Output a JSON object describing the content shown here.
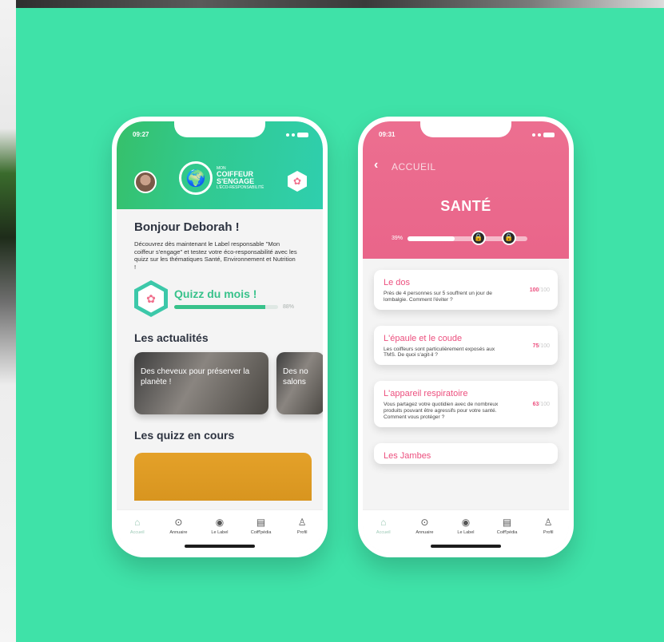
{
  "left_phone": {
    "time": "09:27",
    "logo": {
      "line1": "MON",
      "line2": "COIFFEUR",
      "line3": "S'ENGAGE",
      "tagline": "L'ÉCO-RESPONSABILITÉ"
    },
    "greeting": "Bonjour Deborah !",
    "intro": "Découvrez dès maintenant le Label responsable \"Mon coiffeur s'engage\" et testez votre éco-responsabilité avec les quizz sur les thématiques Santé, Environnement et Nutrition !",
    "quiz_of_month": {
      "title": "Quizz du mois !",
      "progress": 0.88,
      "progress_label": "88%"
    },
    "news_title": "Les actualités",
    "news": [
      {
        "title": "Des cheveux pour préserver la planète !"
      },
      {
        "title": "Des no salons"
      }
    ],
    "quizzes_title": "Les quizz en cours"
  },
  "right_phone": {
    "time": "09:31",
    "back_label": "ACCUEIL",
    "title": "SANTÉ",
    "progress": 0.39,
    "progress_label": "39%",
    "topics": [
      {
        "title": "Le dos",
        "desc": "Près de 4 personnes sur 5 souffrent un jour de lombalgie. Comment l'éviter ?",
        "score": "100",
        "max": "/100"
      },
      {
        "title": "L'épaule et le coude",
        "desc": "Les coiffeurs sont particulièrement exposés aux TMS. De quoi s'agit-il ?",
        "score": "75",
        "max": "/100"
      },
      {
        "title": "L'appareil respiratoire",
        "desc": "Vous partagez votre quotidien avec de nombreux produits pouvant être agressifs pour votre santé. Comment vous protéger ?",
        "score": "63",
        "max": "/100"
      },
      {
        "title": "Les Jambes",
        "desc": "",
        "score": "",
        "max": ""
      }
    ]
  },
  "tabbar": [
    {
      "label": "Accueil",
      "icon": "home-icon"
    },
    {
      "label": "Annuaire",
      "icon": "location-pin-icon"
    },
    {
      "label": "Le Label",
      "icon": "globe-icon"
    },
    {
      "label": "Coiff'pédia",
      "icon": "document-icon"
    },
    {
      "label": "Profil",
      "icon": "user-icon"
    }
  ],
  "colors": {
    "background": "#3fe2a8",
    "green_accent": "#38c28b",
    "pink_accent": "#ec4f7e",
    "pink_header": "#ec6f90"
  }
}
